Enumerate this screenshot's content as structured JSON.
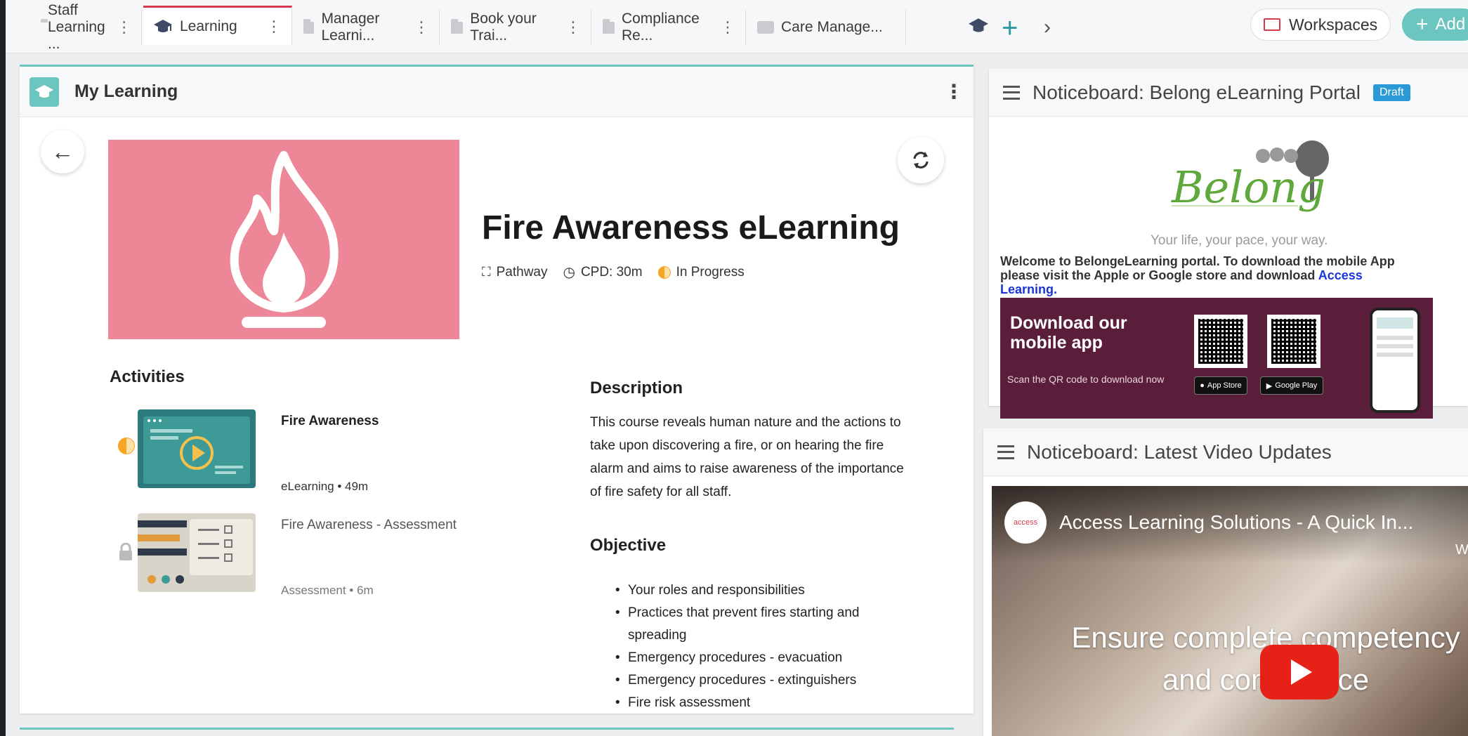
{
  "tabs": [
    {
      "label": "Staff Learning ...",
      "icon": "folder-icon"
    },
    {
      "label": "Learning",
      "icon": "graduation-cap-icon",
      "active": true
    },
    {
      "label": "Manager Learni...",
      "icon": "folder-icon"
    },
    {
      "label": "Book your Trai...",
      "icon": "folder-icon"
    },
    {
      "label": "Compliance Re...",
      "icon": "folder-icon"
    },
    {
      "label": "Care Manage...",
      "icon": "share-icon"
    }
  ],
  "toolbar": {
    "add_tab_symbol": "+",
    "next_symbol": "›",
    "workspaces_label": "Workspaces",
    "add_label": "Add"
  },
  "my_learning": {
    "panel_title": "My Learning",
    "course": {
      "title": "Fire Awareness eLearning",
      "type": "Pathway",
      "cpd": "CPD: 30m",
      "status": "In Progress"
    },
    "activities_heading": "Activities",
    "activities": [
      {
        "title": "Fire Awareness",
        "meta": "eLearning • 49m",
        "status": "in-progress"
      },
      {
        "title": "Fire Awareness - Assessment",
        "meta": "Assessment • 6m",
        "status": "locked"
      }
    ],
    "description_heading": "Description",
    "description": "This course reveals human nature and the actions to take upon discovering a fire, or on hearing the fire alarm and aims to raise awareness of the importance of fire safety for all staff.",
    "objective_heading": "Objective",
    "objectives": [
      "Your roles and responsibilities",
      "Practices that prevent fires starting and spreading",
      "Emergency procedures - evacuation",
      "Emergency procedures - extinguishers",
      "Fire risk assessment"
    ]
  },
  "noticeboard_portal": {
    "title": "Noticeboard: Belong eLearning Portal",
    "badge": "Draft",
    "logo_text": "Belong",
    "tagline": "Your life, your pace, your way.",
    "welcome_text": "Welcome to BelongeLearning portal. To download the mobile App please visit the Apple or Google store and download ",
    "welcome_link": "Access Learning.",
    "banner": {
      "title": "Download our mobile app",
      "subtitle": "Scan the QR code to download now",
      "app_store": "App Store",
      "google_play": "Google Play"
    }
  },
  "noticeboard_video": {
    "title": "Noticeboard: Latest Video Updates",
    "channel": "access",
    "video_title": "Access Learning Solutions - A Quick In...",
    "watch_label": "Watc",
    "overlay_line1": "Ensure complete competency",
    "overlay_line2": "and compliance"
  },
  "colors": {
    "accent": "#6cc6bf",
    "active_tab": "#d63a4f",
    "hero": "#ed8797",
    "banner": "#5b1e3a",
    "progress": "#f6a623",
    "link": "#1a35d8"
  }
}
